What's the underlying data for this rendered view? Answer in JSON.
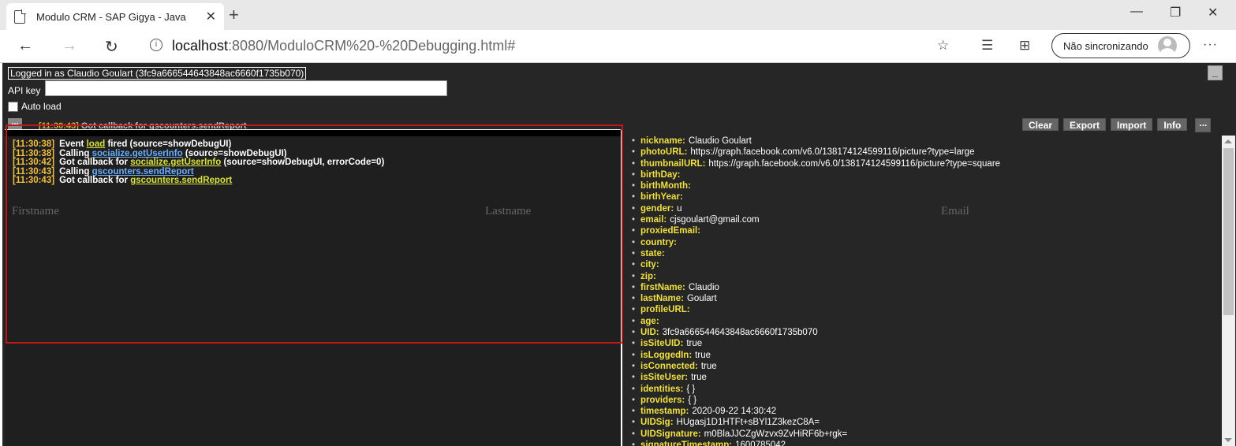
{
  "browser": {
    "tab_title": "Modulo CRM - SAP Gigya - Java",
    "url_host": "localhost",
    "url_rest": ":8080/ModuloCRM%20-%20Debugging.html#",
    "sync_label": "Não sincronizando"
  },
  "header": {
    "logged_in": "Logged in as Claudio Goulart (3fc9a666544643848ac6660f1735b070)",
    "api_key_label": "API key",
    "api_key_value": "",
    "auto_load_label": "Auto load",
    "minimize_label": "_"
  },
  "struck_line": {
    "ts": "[11:30:43]",
    "msg": "Got callback for",
    "link": "gscounters.sendReport"
  },
  "toolbar": {
    "clear": "Clear",
    "export": "Export",
    "import": "Import",
    "info": "Info",
    "dots": "..."
  },
  "log": [
    {
      "ts": "[11:30:38]",
      "pre": "Event",
      "link": "load",
      "post": "fired (source=showDebugUI)"
    },
    {
      "ts": "[11:30:38]",
      "pre": "Calling",
      "link": "socialize.getUserInfo",
      "post": "(source=showDebugUI)"
    },
    {
      "ts": "[11:30:42]",
      "pre": "Got callback for",
      "link": "socialize.getUserInfo",
      "post": "(source=showDebugUI, errorCode=0)"
    },
    {
      "ts": "[11:30:43]",
      "pre": "Calling",
      "link": "gscounters.sendReport",
      "post": ""
    },
    {
      "ts": "[11:30:43]",
      "pre": "Got callback for",
      "link": "gscounters.sendReport",
      "post": ""
    }
  ],
  "columns": {
    "firstname": "Firstname",
    "lastname": "Lastname",
    "email": "Email"
  },
  "details": [
    {
      "k": "nickname:",
      "v": "Claudio Goulart"
    },
    {
      "k": "photoURL:",
      "v": "https://graph.facebook.com/v6.0/138174124599116/picture?type=large"
    },
    {
      "k": "thumbnailURL:",
      "v": "https://graph.facebook.com/v6.0/138174124599116/picture?type=square"
    },
    {
      "k": "birthDay:",
      "v": ""
    },
    {
      "k": "birthMonth:",
      "v": ""
    },
    {
      "k": "birthYear:",
      "v": ""
    },
    {
      "k": "gender:",
      "v": "u"
    },
    {
      "k": "email:",
      "v": "cjsgoulart@gmail.com"
    },
    {
      "k": "proxiedEmail:",
      "v": ""
    },
    {
      "k": "country:",
      "v": ""
    },
    {
      "k": "state:",
      "v": ""
    },
    {
      "k": "city:",
      "v": ""
    },
    {
      "k": "zip:",
      "v": ""
    },
    {
      "k": "firstName:",
      "v": "Claudio"
    },
    {
      "k": "lastName:",
      "v": "Goulart"
    },
    {
      "k": "profileURL:",
      "v": ""
    },
    {
      "k": "age:",
      "v": ""
    },
    {
      "k": "UID:",
      "v": "3fc9a666544643848ac6660f1735b070"
    },
    {
      "k": "isSiteUID:",
      "v": "true"
    },
    {
      "k": "isLoggedIn:",
      "v": "true"
    },
    {
      "k": "isConnected:",
      "v": "true"
    },
    {
      "k": "isSiteUser:",
      "v": "true"
    },
    {
      "k": "identities:",
      "v": "{ }"
    },
    {
      "k": "providers:",
      "v": "{ }"
    },
    {
      "k": "timestamp:",
      "v": "2020-09-22 14:30:42"
    },
    {
      "k": "UIDSig:",
      "v": "HUgasj1D1HTFt+sBYl1Z3kezC8A="
    },
    {
      "k": "UIDSignature:",
      "v": "m0BlaJJCZgWzvx9ZvHiRF6b+rgk="
    },
    {
      "k": "signatureTimestamp:",
      "v": "1600785042"
    }
  ],
  "icons": {
    "page": "page-icon",
    "close": "close-icon",
    "new_tab": "plus-icon",
    "back": "back-arrow-icon",
    "forward": "forward-arrow-icon",
    "refresh": "refresh-icon",
    "info": "info-icon",
    "favorite": "star-icon",
    "favorites": "favorites-list-icon",
    "collections": "collections-icon"
  }
}
